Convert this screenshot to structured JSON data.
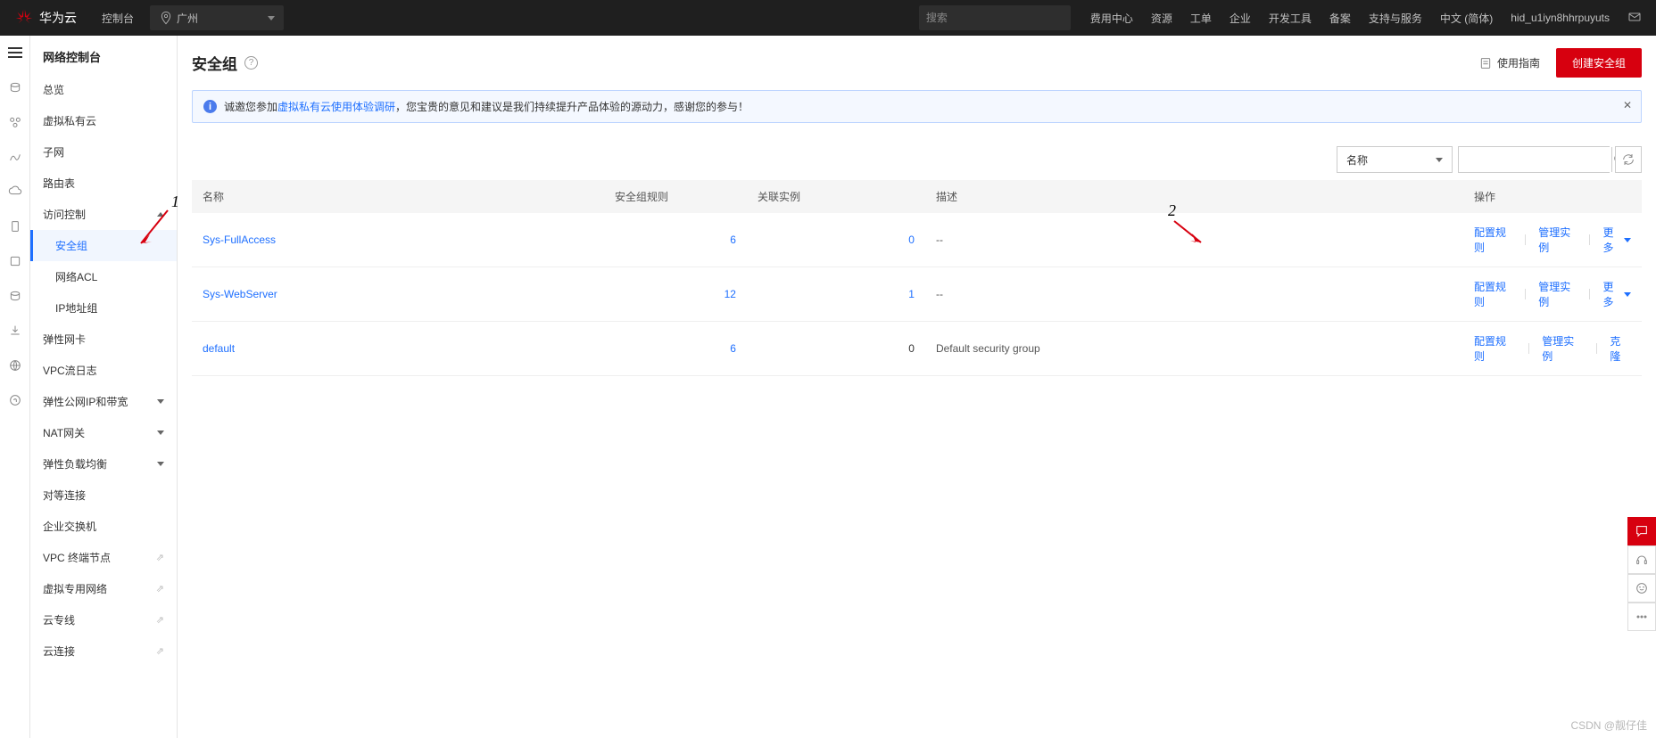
{
  "brand": "华为云",
  "topbar": {
    "console": "控制台",
    "region": "广州",
    "search_placeholder": "搜索",
    "nav": [
      "费用中心",
      "资源",
      "工单",
      "企业",
      "开发工具",
      "备案",
      "支持与服务",
      "中文 (简体)"
    ],
    "user": "hid_u1iyn8hhrpuyuts"
  },
  "sidebar": {
    "title": "网络控制台",
    "items": [
      {
        "label": "总览",
        "type": "item"
      },
      {
        "label": "虚拟私有云",
        "type": "item"
      },
      {
        "label": "子网",
        "type": "item"
      },
      {
        "label": "路由表",
        "type": "item"
      },
      {
        "label": "访问控制",
        "type": "section",
        "expanded": true,
        "children": [
          {
            "label": "安全组",
            "selected": true
          },
          {
            "label": "网络ACL"
          },
          {
            "label": "IP地址组"
          }
        ]
      },
      {
        "label": "弹性网卡",
        "type": "item"
      },
      {
        "label": "VPC流日志",
        "type": "item"
      },
      {
        "label": "弹性公网IP和带宽",
        "type": "section",
        "expanded": false
      },
      {
        "label": "NAT网关",
        "type": "section",
        "expanded": false
      },
      {
        "label": "弹性负载均衡",
        "type": "section",
        "expanded": false
      },
      {
        "label": "对等连接",
        "type": "item"
      },
      {
        "label": "企业交换机",
        "type": "item"
      },
      {
        "label": "VPC 终端节点",
        "type": "external"
      },
      {
        "label": "虚拟专用网络",
        "type": "external"
      },
      {
        "label": "云专线",
        "type": "external"
      },
      {
        "label": "云连接",
        "type": "external"
      }
    ]
  },
  "page": {
    "title": "安全组",
    "guide": "使用指南",
    "create_btn": "创建安全组"
  },
  "notice": {
    "prefix": "诚邀您参加",
    "link": "虚拟私有云使用体验调研",
    "suffix": "，您宝贵的意见和建议是我们持续提升产品体验的源动力，感谢您的参与！"
  },
  "filter": {
    "by_label": "名称"
  },
  "table": {
    "headers": {
      "name": "名称",
      "rules": "安全组规则",
      "instances": "关联实例",
      "desc": "描述",
      "ops": "操作"
    },
    "ops_labels": {
      "config": "配置规则",
      "manage": "管理实例",
      "more": "更多",
      "clone": "克隆"
    },
    "rows": [
      {
        "name": "Sys-FullAccess",
        "rules": "6",
        "instances": "0",
        "desc": "--",
        "ops": "more"
      },
      {
        "name": "Sys-WebServer",
        "rules": "12",
        "instances": "1",
        "desc": "--",
        "ops": "more"
      },
      {
        "name": "default",
        "rules": "6",
        "instances": "0",
        "desc": "Default security group",
        "ops": "clone"
      }
    ]
  },
  "annotations": {
    "one": "1",
    "two": "2"
  },
  "watermark": "CSDN @靓仔佳"
}
